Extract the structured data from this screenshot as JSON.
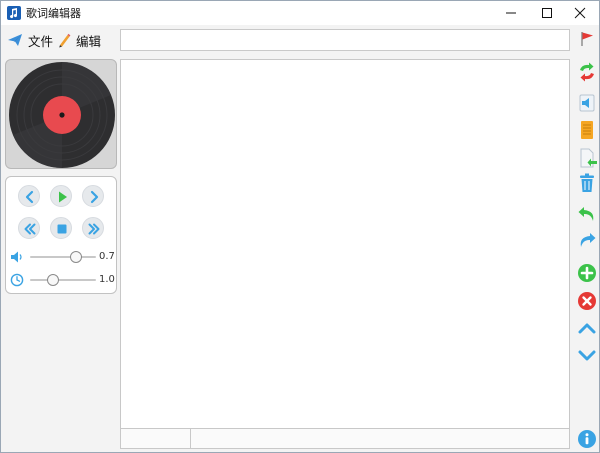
{
  "window": {
    "title": "歌词编辑器",
    "controls": [
      "minimize",
      "maximize",
      "close"
    ]
  },
  "menu": {
    "file_label": "文件",
    "edit_label": "编辑"
  },
  "top_input": {
    "value": ""
  },
  "player": {
    "volume_value": "0.7",
    "speed_value": "1.0",
    "volume_fraction": 0.7,
    "speed_fraction": 0.35
  },
  "status": {
    "cell1": "",
    "cell2": ""
  },
  "icons": {
    "flag": "flag-icon",
    "refresh": "refresh-icon",
    "speaker": "speaker-icon",
    "notes": "notes-icon",
    "import": "import-icon",
    "trash": "trash-icon",
    "undo": "undo-icon",
    "redo": "redo-icon",
    "add": "add-icon",
    "delete": "delete-icon",
    "up": "up-icon",
    "down": "down-icon",
    "help": "help-icon"
  },
  "colors": {
    "accent_blue": "#3aa3e3",
    "green": "#3cc24a",
    "red": "#e53935",
    "record_label": "#e84a4f"
  }
}
